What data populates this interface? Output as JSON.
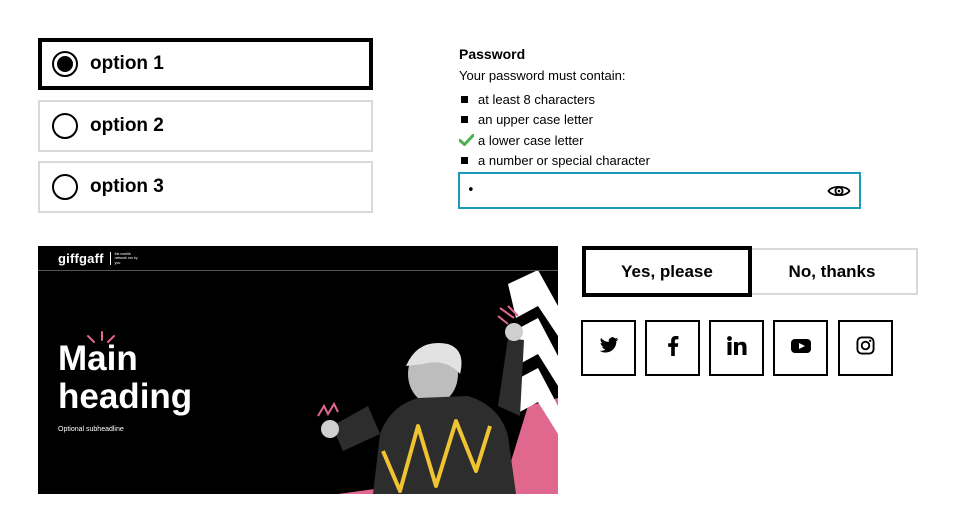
{
  "radio_group": {
    "options": [
      {
        "label": "option 1",
        "selected": true
      },
      {
        "label": "option 2",
        "selected": false
      },
      {
        "label": "option 3",
        "selected": false
      }
    ]
  },
  "password": {
    "title": "Password",
    "description": "Your password must contain:",
    "requirements": [
      {
        "text": "at least 8 characters",
        "met": false
      },
      {
        "text": "an upper case letter",
        "met": false
      },
      {
        "text": "a lower case letter",
        "met": true
      },
      {
        "text": "a number or special character",
        "met": false
      }
    ],
    "value": "•",
    "focus_color": "#1a9bb8",
    "check_color": "#4caf50",
    "toggle_icon": "eye-icon"
  },
  "hero": {
    "logo": "giffgaff",
    "tagline": "the mobile network run by you",
    "heading_line1": "Main",
    "heading_line2": "heading",
    "subheadline": "Optional subheadline",
    "accent_pink": "#e0678d",
    "accent_yellow": "#f0c330"
  },
  "consent": {
    "yes_label": "Yes, please",
    "no_label": "No, thanks",
    "selected": "yes"
  },
  "social": [
    {
      "name": "twitter-icon"
    },
    {
      "name": "facebook-icon"
    },
    {
      "name": "linkedin-icon"
    },
    {
      "name": "youtube-icon"
    },
    {
      "name": "instagram-icon"
    }
  ]
}
